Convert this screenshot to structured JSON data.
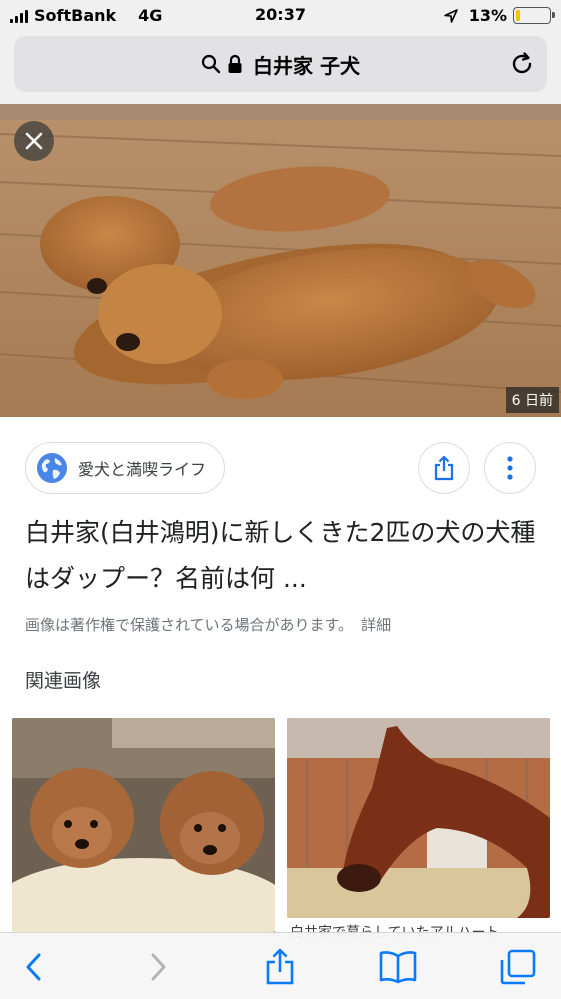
{
  "status_bar": {
    "carrier": "SoftBank",
    "network": "4G",
    "time": "20:37",
    "battery": "13%",
    "battery_level": 0.13
  },
  "address_bar": {
    "query": "白井家 子犬"
  },
  "hero": {
    "age": "6 日前"
  },
  "source": {
    "name": "愛犬と満喫ライフ"
  },
  "result": {
    "title": "白井家(白井鴻明)に新しくきた2匹の犬の犬種はダップー？名前は何 ...",
    "copyright": "画像は著作権で保護されている場合があります。",
    "details": "詳細"
  },
  "related": {
    "heading": "関連画像",
    "items": [
      {
        "caption": ""
      },
      {
        "caption": "白井家で暮らしていたアルハート"
      }
    ]
  },
  "colors": {
    "accent": "#1a73e8",
    "safari_blue": "#0a7aff"
  }
}
